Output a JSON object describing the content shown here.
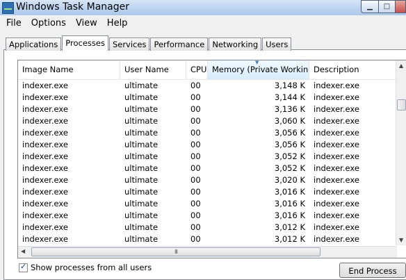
{
  "window": {
    "title": "Windows Task Manager"
  },
  "menu": [
    "File",
    "Options",
    "View",
    "Help"
  ],
  "tabs": [
    "Applications",
    "Processes",
    "Services",
    "Performance",
    "Networking",
    "Users"
  ],
  "active_tab": "Processes",
  "table": {
    "columns": [
      "Image Name",
      "User Name",
      "CPU",
      "Memory (Private Working...",
      "Description"
    ],
    "sorted_column": "Memory (Private Working...",
    "rows": [
      {
        "image": "indexer.exe",
        "user": "ultimate",
        "cpu": "00",
        "memory": "3,148 K",
        "description": "indexer.exe"
      },
      {
        "image": "indexer.exe",
        "user": "ultimate",
        "cpu": "00",
        "memory": "3,144 K",
        "description": "indexer.exe"
      },
      {
        "image": "indexer.exe",
        "user": "ultimate",
        "cpu": "00",
        "memory": "3,136 K",
        "description": "indexer.exe"
      },
      {
        "image": "indexer.exe",
        "user": "ultimate",
        "cpu": "00",
        "memory": "3,060 K",
        "description": "indexer.exe"
      },
      {
        "image": "indexer.exe",
        "user": "ultimate",
        "cpu": "00",
        "memory": "3,056 K",
        "description": "indexer.exe"
      },
      {
        "image": "indexer.exe",
        "user": "ultimate",
        "cpu": "00",
        "memory": "3,056 K",
        "description": "indexer.exe"
      },
      {
        "image": "indexer.exe",
        "user": "ultimate",
        "cpu": "00",
        "memory": "3,052 K",
        "description": "indexer.exe"
      },
      {
        "image": "indexer.exe",
        "user": "ultimate",
        "cpu": "00",
        "memory": "3,052 K",
        "description": "indexer.exe"
      },
      {
        "image": "indexer.exe",
        "user": "ultimate",
        "cpu": "00",
        "memory": "3,020 K",
        "description": "indexer.exe"
      },
      {
        "image": "indexer.exe",
        "user": "ultimate",
        "cpu": "00",
        "memory": "3,016 K",
        "description": "indexer.exe"
      },
      {
        "image": "indexer.exe",
        "user": "ultimate",
        "cpu": "00",
        "memory": "3,016 K",
        "description": "indexer.exe"
      },
      {
        "image": "indexer.exe",
        "user": "ultimate",
        "cpu": "00",
        "memory": "3,016 K",
        "description": "indexer.exe"
      },
      {
        "image": "indexer.exe",
        "user": "ultimate",
        "cpu": "00",
        "memory": "3,012 K",
        "description": "indexer.exe"
      },
      {
        "image": "indexer.exe",
        "user": "ultimate",
        "cpu": "00",
        "memory": "3,012 K",
        "description": "indexer.exe"
      }
    ]
  },
  "scrollbar": {
    "h_thumb_grip": "III"
  },
  "footer": {
    "show_all_label": "Show processes from all users",
    "show_all_checked": true,
    "end_process_label": "End Process"
  },
  "icons": [
    "task-manager-icon",
    "minimize-icon",
    "maximize-icon",
    "close-icon",
    "sort-arrow-icon",
    "checkbox-checked-icon"
  ]
}
